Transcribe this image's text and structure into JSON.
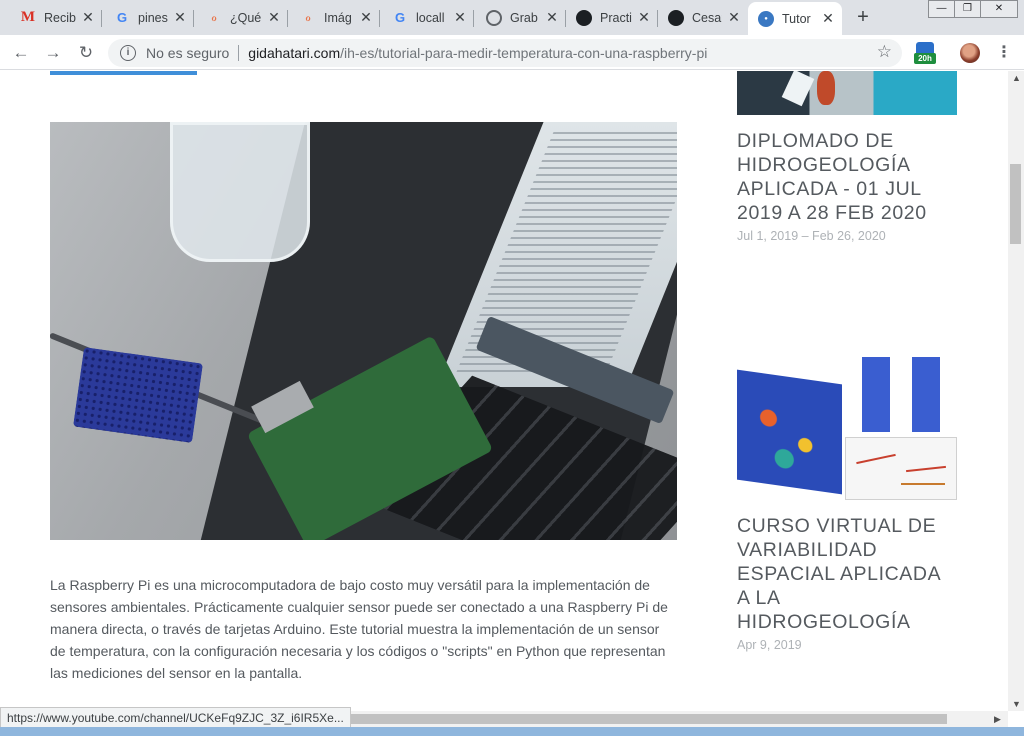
{
  "browser": {
    "tabs": [
      {
        "title": "Recib",
        "favicon": "gmail-icon",
        "active": false
      },
      {
        "title": "pines",
        "favicon": "google-icon",
        "active": false
      },
      {
        "title": "¿Qué",
        "favicon": "pin-icon",
        "active": false
      },
      {
        "title": "Imág",
        "favicon": "pin-icon",
        "active": false
      },
      {
        "title": "locall",
        "favicon": "google-icon",
        "active": false
      },
      {
        "title": "Grab",
        "favicon": "globe-icon",
        "active": false
      },
      {
        "title": "Practi",
        "favicon": "github-icon",
        "active": false
      },
      {
        "title": "Cesar",
        "favicon": "github-icon",
        "active": false
      },
      {
        "title": "Tutor",
        "favicon": "gidahatari-icon",
        "active": true
      }
    ],
    "security_label": "No es seguro",
    "url_host": "gidahatari.com",
    "url_path": "/ih-es/tutorial-para-medir-temperatura-con-una-raspberry-pi",
    "extension_badge": "20h",
    "status_url": "https://www.youtube.com/channel/UCKeFq9ZJC_3Z_i6IR5Xe..."
  },
  "article": {
    "paragraph": "La Raspberry Pi es una microcomputadora de bajo costo muy versátil para la implementación de sensores ambientales. Prácticamente cualquier sensor puede ser conectado a una Raspberry Pi de manera directa, o través de tarjetas Arduino. Este tutorial muestra la implementación de un sensor de temperatura, con la configuración necesaria y los códigos o \"scripts\" en Python que representan las mediciones del sensor en la pantalla."
  },
  "sidebar": {
    "posts": [
      {
        "title": "Diplomado de Hidrogeología Aplicada - 01 Jul 2019 a 28 Feb 2020",
        "date": "Jul 1, 2019 – Feb 26, 2020"
      },
      {
        "title": "Curso Virtual de Variabilidad Espacial Aplicada a la Hidrogeología",
        "date": "Apr 9, 2019"
      }
    ]
  }
}
